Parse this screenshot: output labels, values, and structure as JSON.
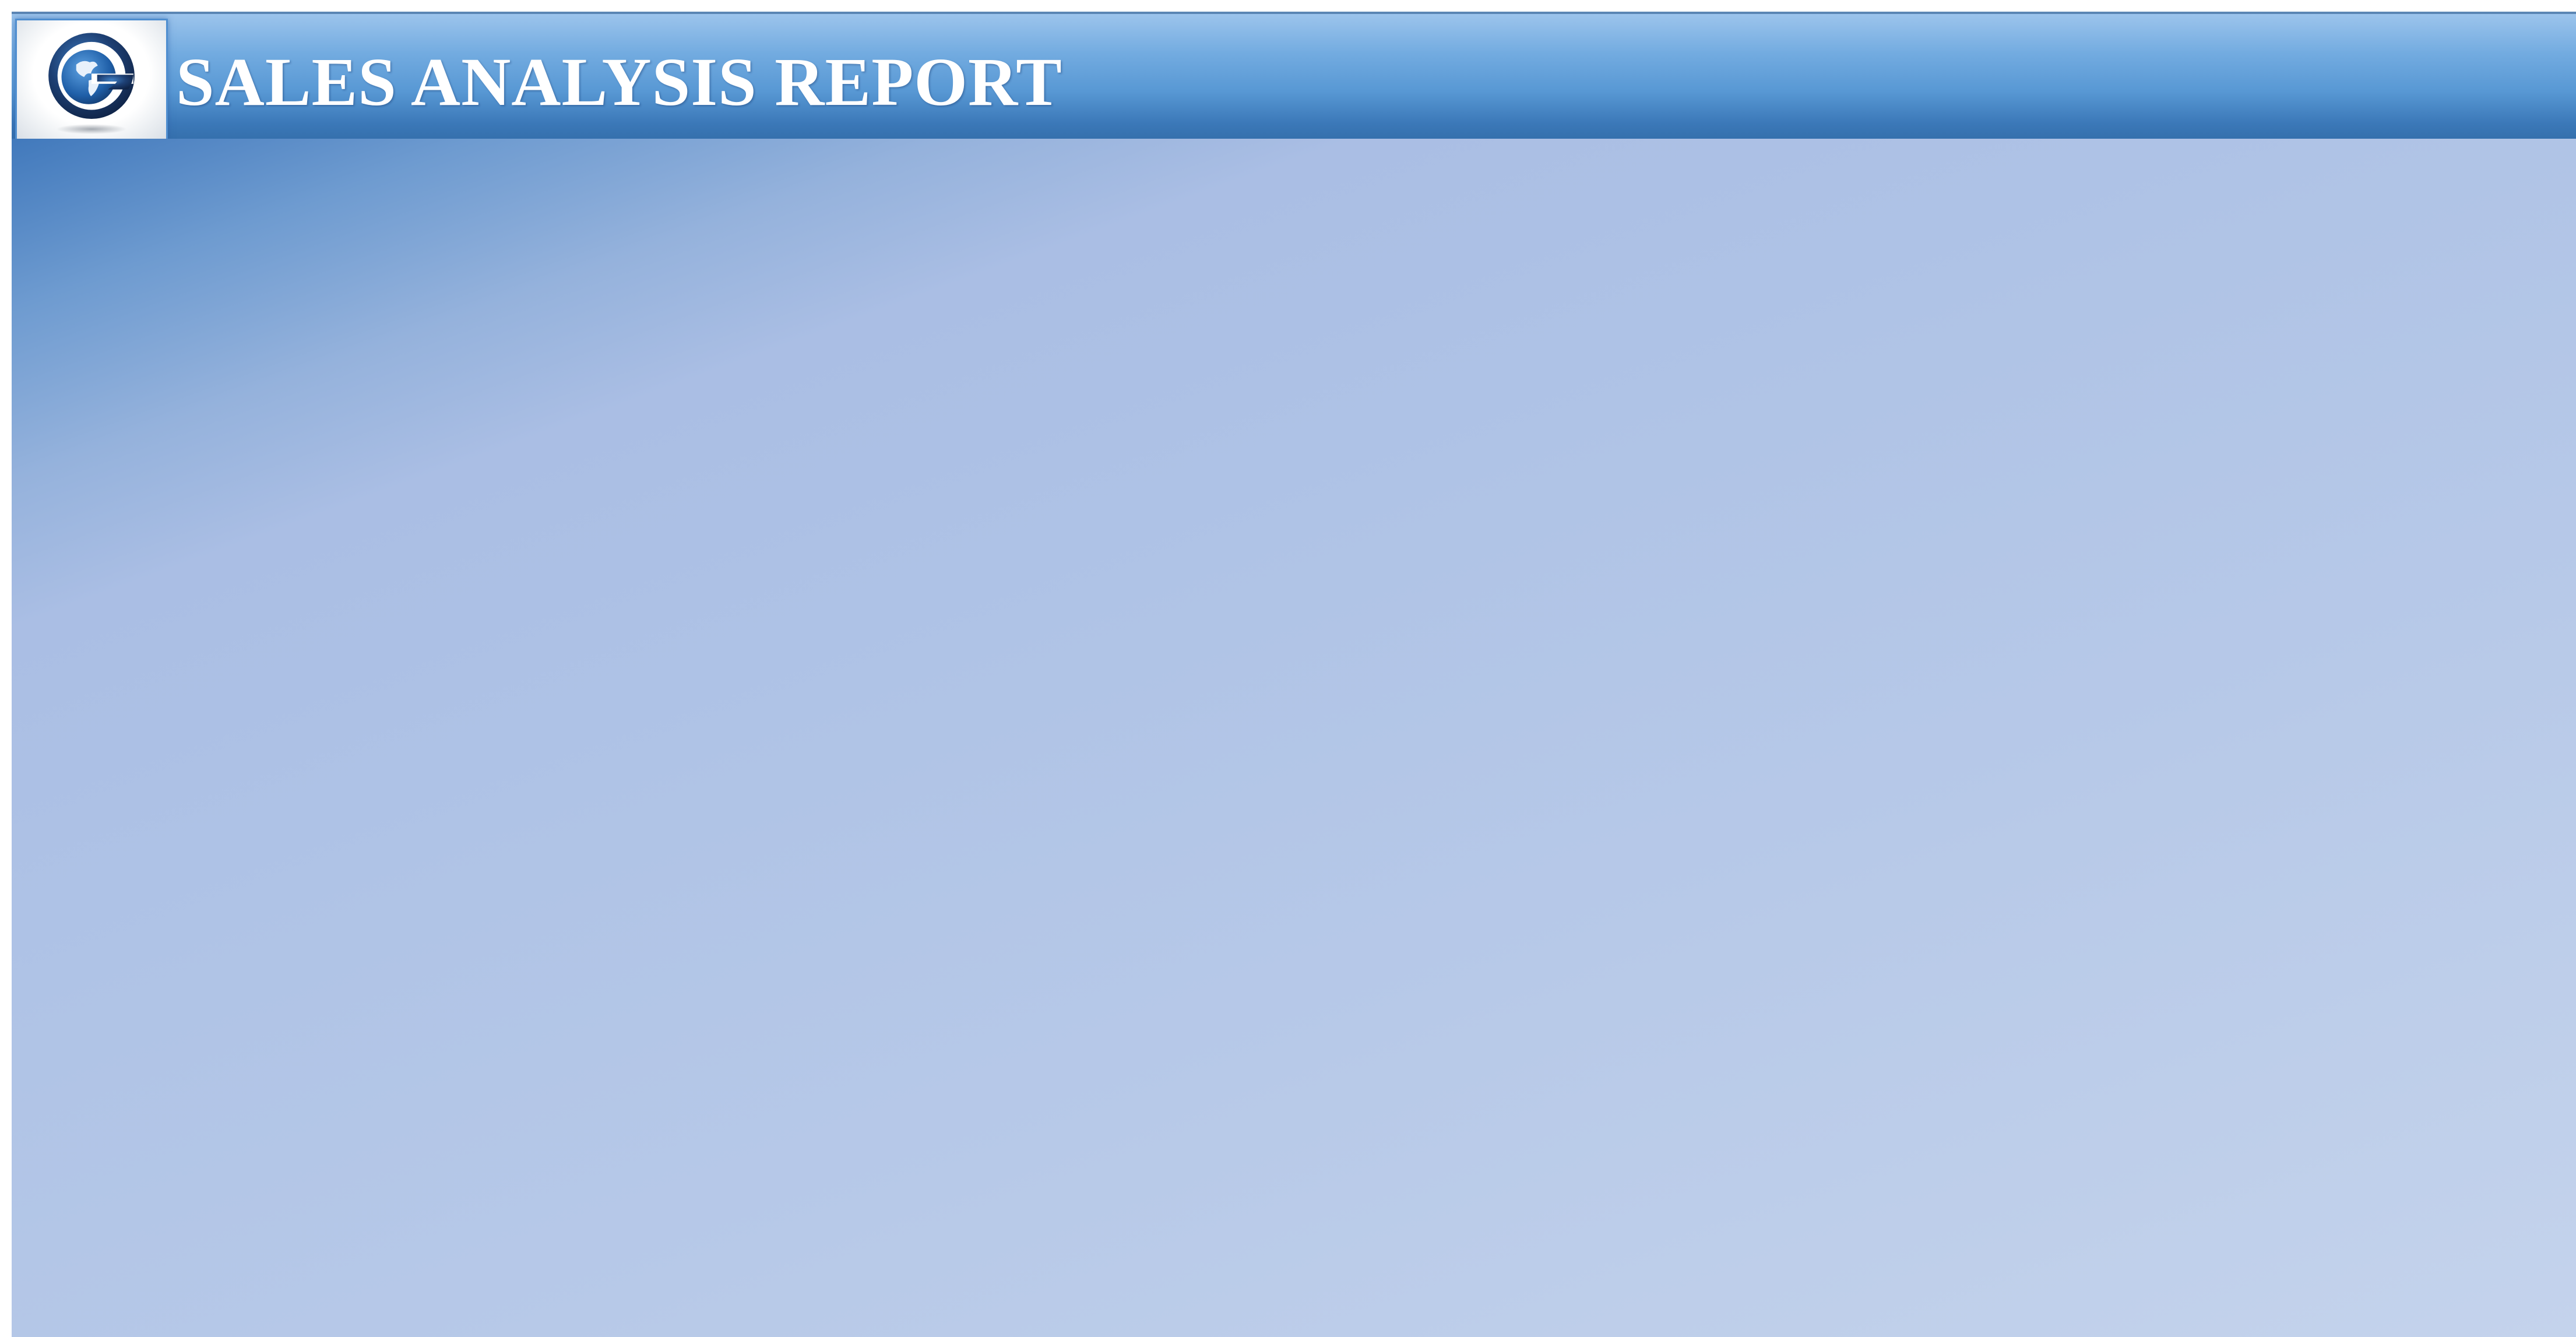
{
  "header": {
    "title": "SALES ANALYSIS REPORT",
    "logo_icon": "globe-g-logo-icon"
  },
  "colors": {
    "title_bar_top": "#9cc4ec",
    "title_bar_bottom": "#3570ad",
    "content_top_left": "#4179bc",
    "content_body": "#b4c7e7",
    "title_text": "#ffffff",
    "logo_ring": "#1d3f73"
  }
}
